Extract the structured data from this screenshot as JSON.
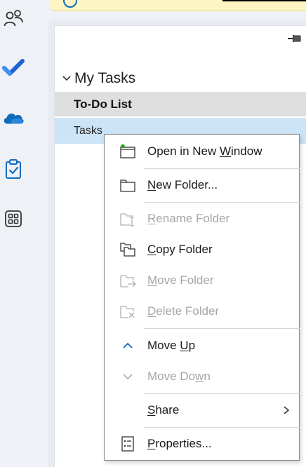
{
  "rail": {
    "items": [
      {
        "name": "people",
        "icon": "people-icon"
      },
      {
        "name": "todo",
        "icon": "checkmark-icon"
      },
      {
        "name": "onedrive",
        "icon": "cloud-icon"
      },
      {
        "name": "tasks",
        "icon": "clipboard-check-icon"
      },
      {
        "name": "apps",
        "icon": "apps-grid-icon"
      }
    ]
  },
  "folder_pane": {
    "group_label": "My Tasks",
    "folders": [
      {
        "label": "To-Do List",
        "selected": false
      },
      {
        "label": "Tasks",
        "selected": true
      }
    ]
  },
  "context_menu": {
    "items": [
      {
        "icon": "open-new-window-icon",
        "pre": "Open in New ",
        "key": "W",
        "post": "indow",
        "enabled": true
      },
      {
        "icon": "new-folder-icon",
        "pre": "",
        "key": "N",
        "post": "ew Folder...",
        "enabled": true
      },
      {
        "icon": "rename-folder-icon",
        "pre": "",
        "key": "R",
        "post": "ename Folder",
        "enabled": false
      },
      {
        "icon": "copy-folder-icon",
        "pre": "",
        "key": "C",
        "post": "opy Folder",
        "enabled": true
      },
      {
        "icon": "move-folder-icon",
        "pre": "",
        "key": "M",
        "post": "ove Folder",
        "enabled": false
      },
      {
        "icon": "delete-folder-icon",
        "pre": "",
        "key": "D",
        "post": "elete Folder",
        "enabled": false
      },
      {
        "icon": "chevron-up-icon",
        "pre": "Move ",
        "key": "U",
        "post": "p",
        "enabled": true
      },
      {
        "icon": "chevron-down-icon",
        "pre": "Move Do",
        "key": "w",
        "post": "n",
        "enabled": false
      },
      {
        "icon": "",
        "pre": "",
        "key": "S",
        "post": "hare",
        "enabled": true,
        "submenu": true
      },
      {
        "icon": "properties-icon",
        "pre": "",
        "key": "P",
        "post": "roperties...",
        "enabled": true
      }
    ]
  },
  "colors": {
    "accent": "#0f6cbd",
    "selected_row": "#cce4f7",
    "disabled_text": "#a6a6a6",
    "new_badge": "#13a10e",
    "banner": "#fdf6c3"
  }
}
